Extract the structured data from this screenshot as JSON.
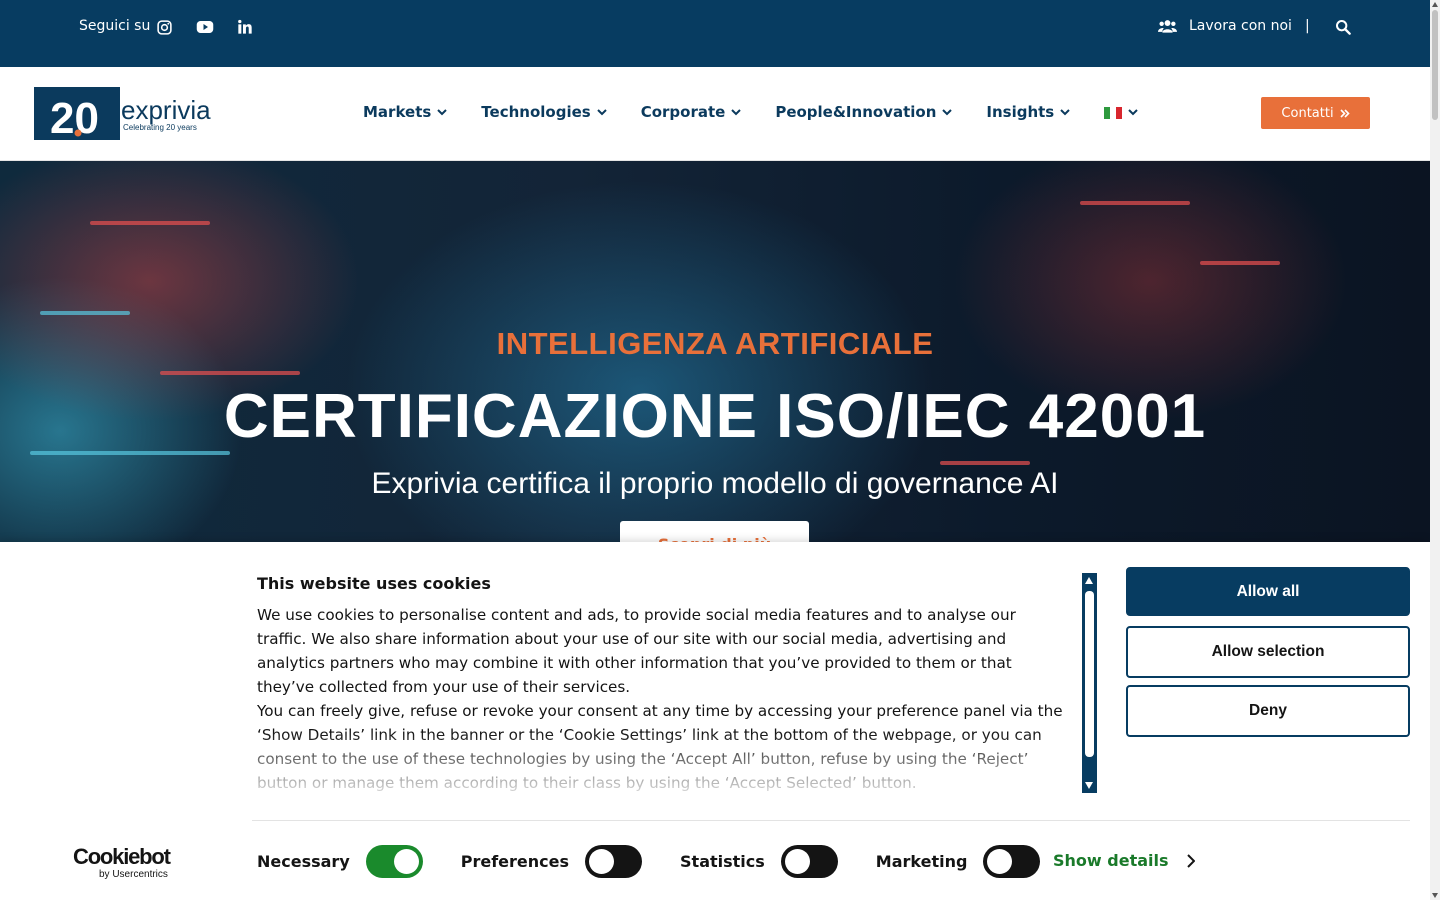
{
  "topbar": {
    "follow_label": "Seguici su",
    "social_icons": [
      "instagram-icon",
      "youtube-icon",
      "linkedin-icon"
    ],
    "work_label": "Lavora con noi",
    "separator": "|",
    "search_icon": "search-icon"
  },
  "header": {
    "logo_number": "20",
    "logo_brand": "exprivia",
    "logo_tagline": "Celebrating 20 years",
    "nav": [
      {
        "label": "Markets"
      },
      {
        "label": "Technologies"
      },
      {
        "label": "Corporate"
      },
      {
        "label": "People&Innovation"
      },
      {
        "label": "Insights"
      }
    ],
    "language_icon": "italian-flag-icon",
    "contact_label": "Contatti",
    "contact_icon": "double-chevron-right-icon"
  },
  "hero": {
    "kicker": "INTELLIGENZA ARTIFICIALE",
    "title": "CERTIFICAZIONE ISO/IEC 42001",
    "subtitle": "Exprivia certifica il proprio modello di governance AI",
    "cta_label": "Scopri di più"
  },
  "cookie": {
    "heading": "This website uses cookies",
    "paragraph1": "We use cookies to personalise content and ads, to provide social media features and to analyse our traffic. We also share information about your use of our site with our social media, advertising and analytics partners who may combine it with other information that you’ve provided to them or that they’ve collected from your use of their services.",
    "paragraph2": "You can freely give, refuse or revoke your consent at any time by accessing your preference panel via the ‘Show Details’ link in the banner or the ‘Cookie Settings’ link at the bottom of the webpage, or you can consent to the use of these technologies by using the ‘Accept All’ button, refuse by using the ‘Reject’ button or manage them according to their class by using the ‘Accept Selected’ button.",
    "buttons": {
      "allow_all": "Allow all",
      "allow_selection": "Allow selection",
      "deny": "Deny"
    },
    "brand_big": "Cookiebot",
    "brand_small": "by Usercentrics",
    "toggles": [
      {
        "label": "Necessary",
        "on": true
      },
      {
        "label": "Preferences",
        "on": false
      },
      {
        "label": "Statistics",
        "on": false
      },
      {
        "label": "Marketing",
        "on": false
      }
    ],
    "show_details": "Show details",
    "colors": {
      "primary": "#073c61",
      "accent": "#e8703a",
      "toggle_on": "#1a8a2c",
      "link": "#1a7a2a"
    }
  }
}
